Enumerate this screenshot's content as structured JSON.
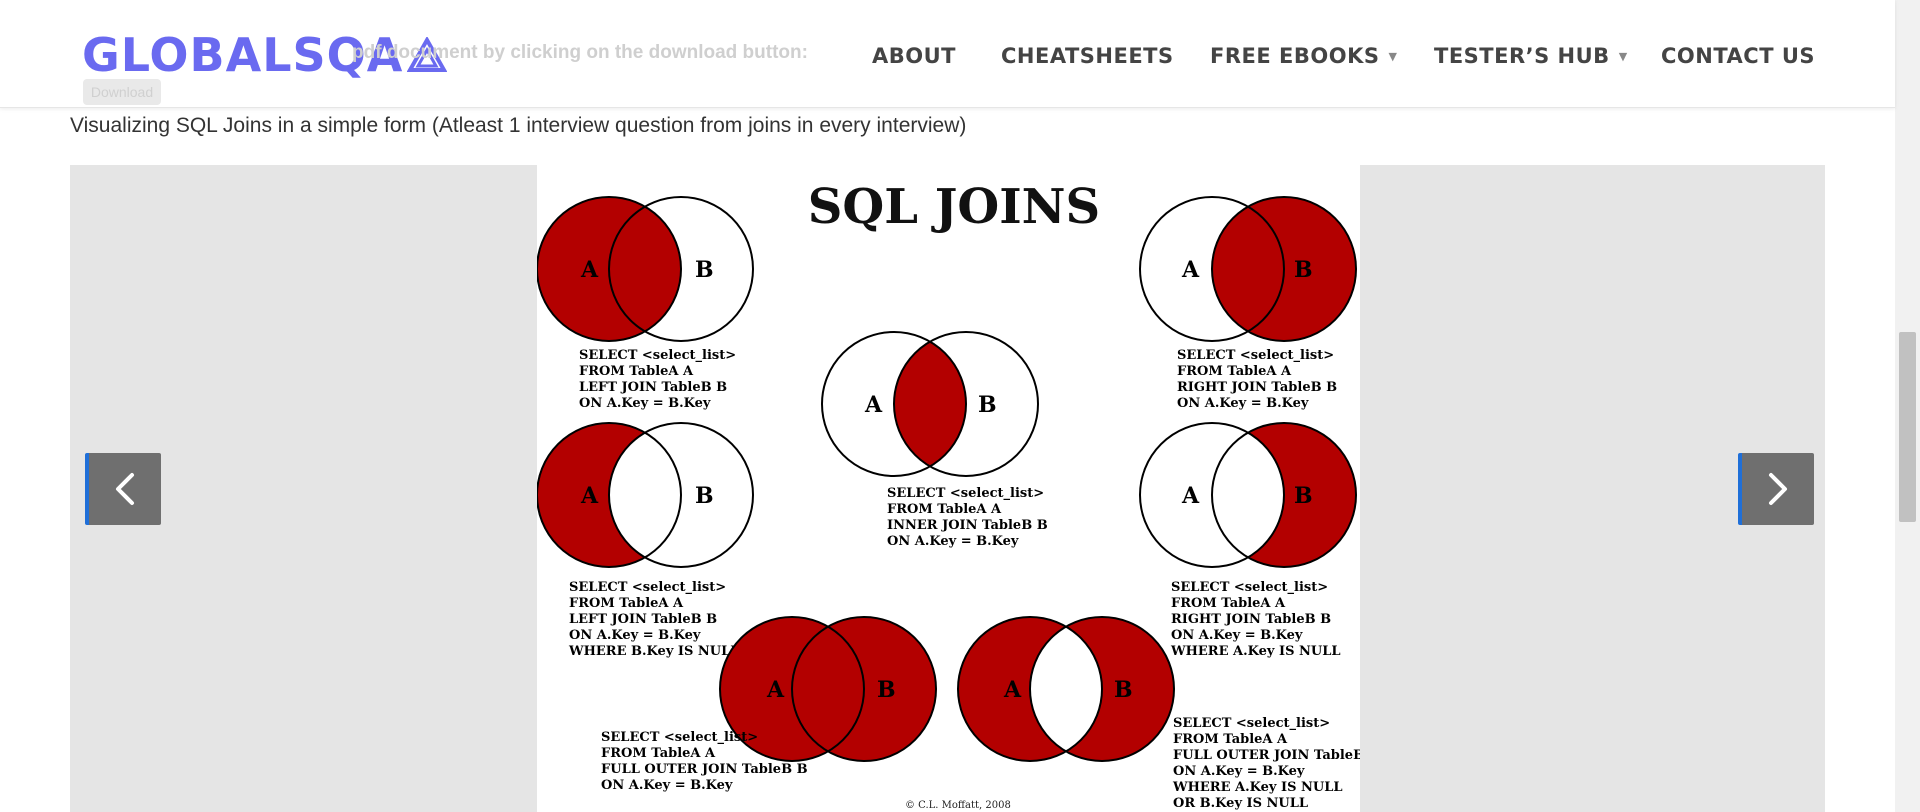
{
  "header": {
    "logo_text": "GLOBALSQA",
    "ghost_text": "pdf document by clicking on the download button:",
    "ghost_button": "Download",
    "nav": [
      {
        "label": "ABOUT"
      },
      {
        "label": "CHEATSHEETS"
      },
      {
        "label": "FREE EBOOKS",
        "has_dropdown": true
      },
      {
        "label": "TESTER’S HUB",
        "has_dropdown": true
      },
      {
        "label": "CONTACT US"
      }
    ]
  },
  "content": {
    "intro": "Visualizing SQL Joins in a simple form (Atleast 1 interview question from joins in every interview)"
  },
  "diagram": {
    "title": "SQL JOINS",
    "label_a": "A",
    "label_b": "B",
    "fill_color": "#b30000",
    "copyright": "© C.L. Moffatt, 2008",
    "joins": [
      {
        "id": "left_join",
        "lines": [
          "SELECT <select_list>",
          "FROM TableA A",
          "LEFT JOIN TableB B",
          "ON A.Key = B.Key"
        ]
      },
      {
        "id": "right_join",
        "lines": [
          "SELECT <select_list>",
          "FROM TableA A",
          "RIGHT JOIN TableB B",
          "ON A.Key = B.Key"
        ]
      },
      {
        "id": "inner_join",
        "lines": [
          "SELECT <select_list>",
          "FROM TableA A",
          "INNER JOIN TableB B",
          "ON A.Key = B.Key"
        ]
      },
      {
        "id": "left_excl",
        "lines": [
          "SELECT <select_list>",
          "FROM TableA A",
          "LEFT JOIN TableB B",
          "ON A.Key = B.Key",
          "WHERE B.Key IS NULL"
        ]
      },
      {
        "id": "right_excl",
        "lines": [
          "SELECT <select_list>",
          "FROM TableA A",
          "RIGHT JOIN TableB B",
          "ON A.Key = B.Key",
          "WHERE A.Key IS NULL"
        ]
      },
      {
        "id": "full_outer",
        "lines": [
          "SELECT <select_list>",
          "FROM TableA A",
          "FULL OUTER JOIN TableB B",
          "ON A.Key = B.Key"
        ]
      },
      {
        "id": "full_excl",
        "lines": [
          "SELECT <select_list>",
          "FROM TableA A",
          "FULL OUTER JOIN TableB B",
          "ON A.Key = B.Key",
          "WHERE A.Key IS NULL",
          "OR B.Key IS NULL"
        ]
      }
    ]
  },
  "slider": {
    "prev_icon": "chevron-left-icon",
    "next_icon": "chevron-right-icon"
  }
}
